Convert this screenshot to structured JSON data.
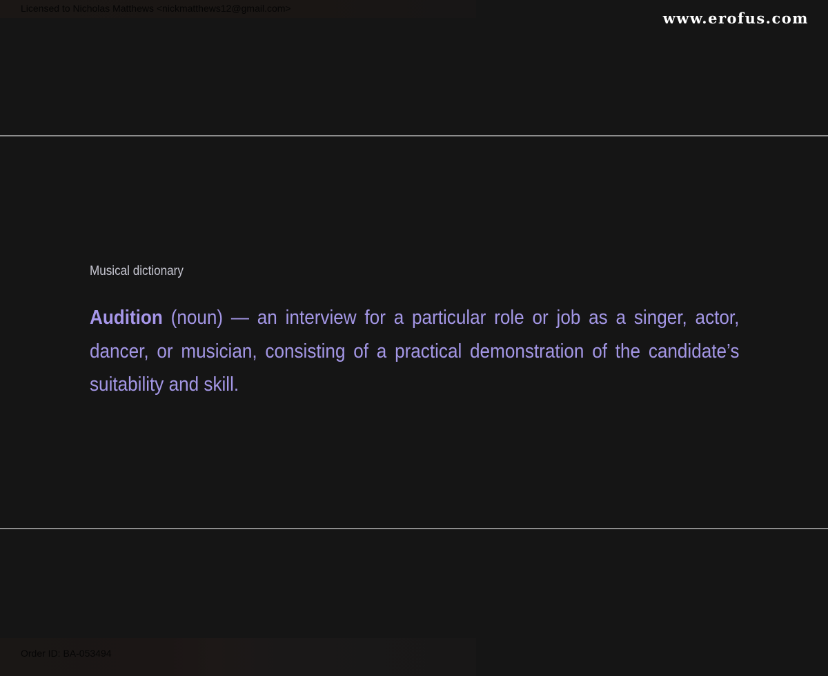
{
  "license": {
    "text": "Licensed to Nicholas Matthews <nickmatthews12@gmail.com>"
  },
  "watermark": {
    "text": "www.erofus.com"
  },
  "dictionary": {
    "label": "Musical dictionary",
    "term": "Audition",
    "definition": " (noun) — an interview for a particular role or job as a singer, actor, dancer, or musician, consisting of a practical demonstration of the candidate’s suitability and skill."
  },
  "order": {
    "text": "Order ID: BA-053494"
  },
  "colors": {
    "background": "#151515",
    "definition_text": "#a497e6",
    "rule": "#8d8d8d"
  }
}
